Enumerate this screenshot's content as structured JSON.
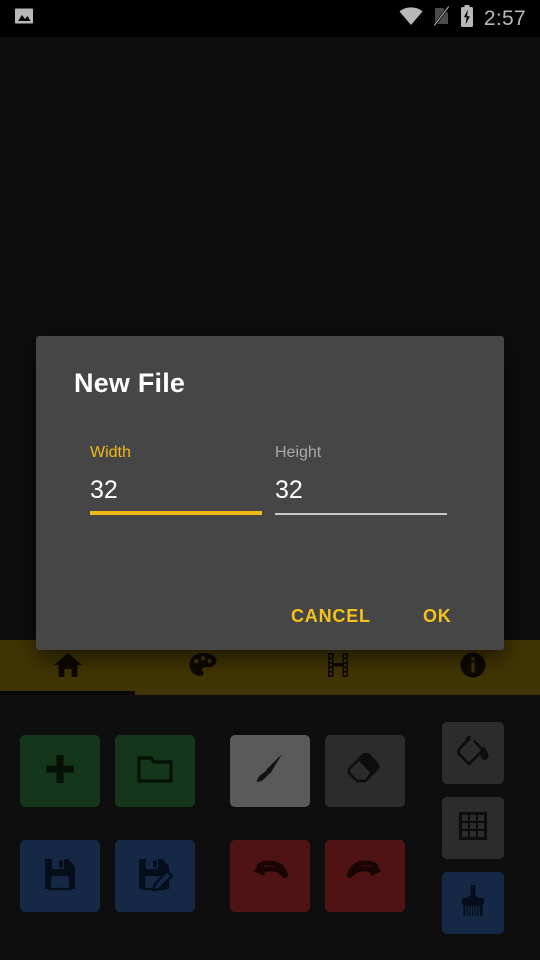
{
  "statusbar": {
    "notification_icon": "image-icon",
    "wifi_icon": "wifi-icon",
    "sim_icon": "no-sim-icon",
    "battery_icon": "battery-charging-icon",
    "time": "2:57"
  },
  "tabs": [
    {
      "name": "tab-home",
      "icon": "home-icon",
      "active": true
    },
    {
      "name": "tab-palette",
      "icon": "palette-icon",
      "active": false
    },
    {
      "name": "tab-film",
      "icon": "film-icon",
      "active": false
    },
    {
      "name": "tab-info",
      "icon": "info-icon",
      "active": false
    }
  ],
  "toolbar": {
    "buttons": [
      {
        "name": "new-button",
        "icon": "plus-icon",
        "color": "#1d4c25"
      },
      {
        "name": "open-button",
        "icon": "folder-icon",
        "color": "#1d4c25"
      },
      {
        "name": "brush-tool",
        "icon": "paintbrush-icon",
        "color": "#7d7d7d"
      },
      {
        "name": "eraser-tool",
        "icon": "eraser-icon",
        "color": "#3e3e3e"
      },
      {
        "name": "save-button",
        "icon": "floppy-icon",
        "color": "#1e3a63"
      },
      {
        "name": "save-as-button",
        "icon": "floppy-edit-icon",
        "color": "#1e3a63"
      },
      {
        "name": "undo-button",
        "icon": "undo-arrow-icon",
        "color": "#6e1b1b"
      },
      {
        "name": "redo-button",
        "icon": "redo-arrow-icon",
        "color": "#6e1b1b"
      },
      {
        "name": "fill-tool",
        "icon": "paint-bucket-icon",
        "color": "#3e3e3e"
      },
      {
        "name": "grid-toggle",
        "icon": "grid-icon",
        "color": "#3e3e3e"
      },
      {
        "name": "wide-brush-tool",
        "icon": "wide-brush-icon",
        "color": "#1e3a63"
      }
    ]
  },
  "dialog": {
    "title": "New File",
    "width_field": {
      "label": "Width",
      "value": "32"
    },
    "height_field": {
      "label": "Height",
      "value": "32"
    },
    "cancel_label": "CANCEL",
    "ok_label": "OK"
  },
  "colors": {
    "accent": "#f5c21b",
    "dialog_bg": "#464646",
    "tabbar_bg": "#5b4906",
    "app_bg": "#121212"
  }
}
